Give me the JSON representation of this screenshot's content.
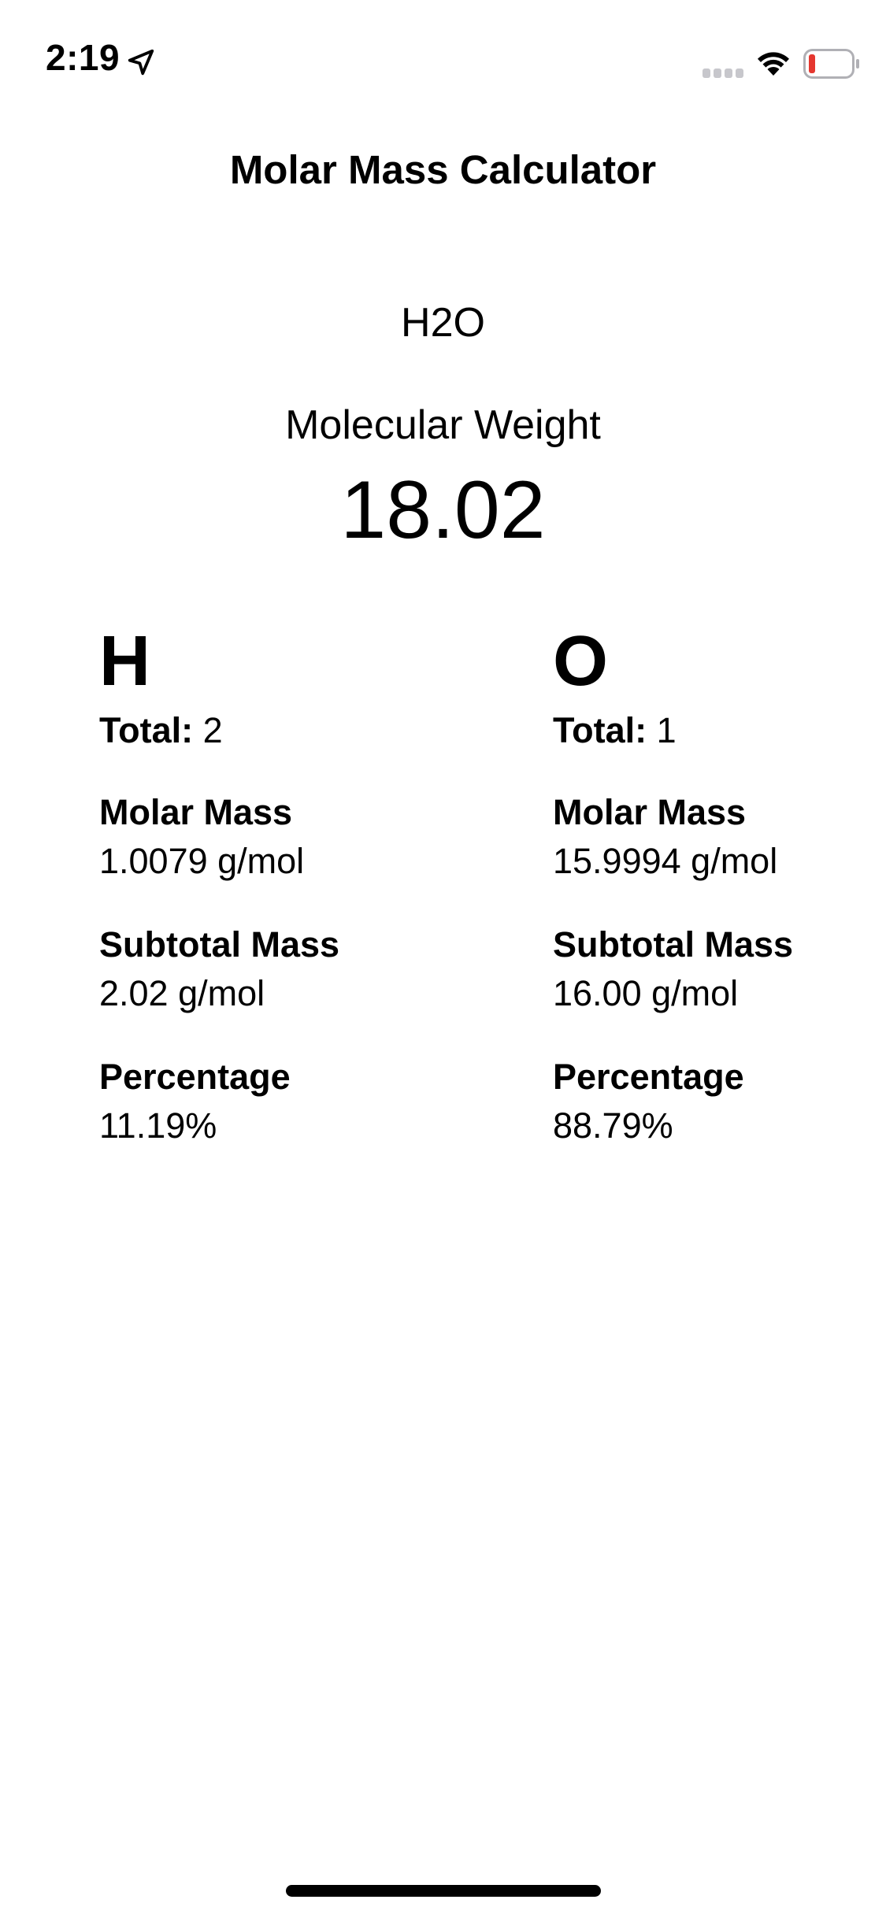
{
  "status_bar": {
    "time": "2:19",
    "icons": [
      "location-arrow-icon",
      "signal-icon",
      "wifi-icon",
      "battery-low-icon"
    ],
    "battery_color": "#e5372f"
  },
  "nav": {
    "title": "Molar Mass Calculator"
  },
  "compound": {
    "formula": "H2O",
    "weight_label": "Molecular Weight",
    "weight_value": "18.02"
  },
  "elements": [
    {
      "symbol": "H",
      "total_label": "Total:",
      "total_value": "2",
      "molar_mass_label": "Molar Mass",
      "molar_mass_value": "1.0079 g/mol",
      "subtotal_label": "Subtotal Mass",
      "subtotal_value": "2.02 g/mol",
      "percentage_label": "Percentage",
      "percentage_value": "11.19%"
    },
    {
      "symbol": "O",
      "total_label": "Total:",
      "total_value": "1",
      "molar_mass_label": "Molar Mass",
      "molar_mass_value": "15.9994 g/mol",
      "subtotal_label": "Subtotal Mass",
      "subtotal_value": "16.00 g/mol",
      "percentage_label": "Percentage",
      "percentage_value": "88.79%"
    }
  ]
}
